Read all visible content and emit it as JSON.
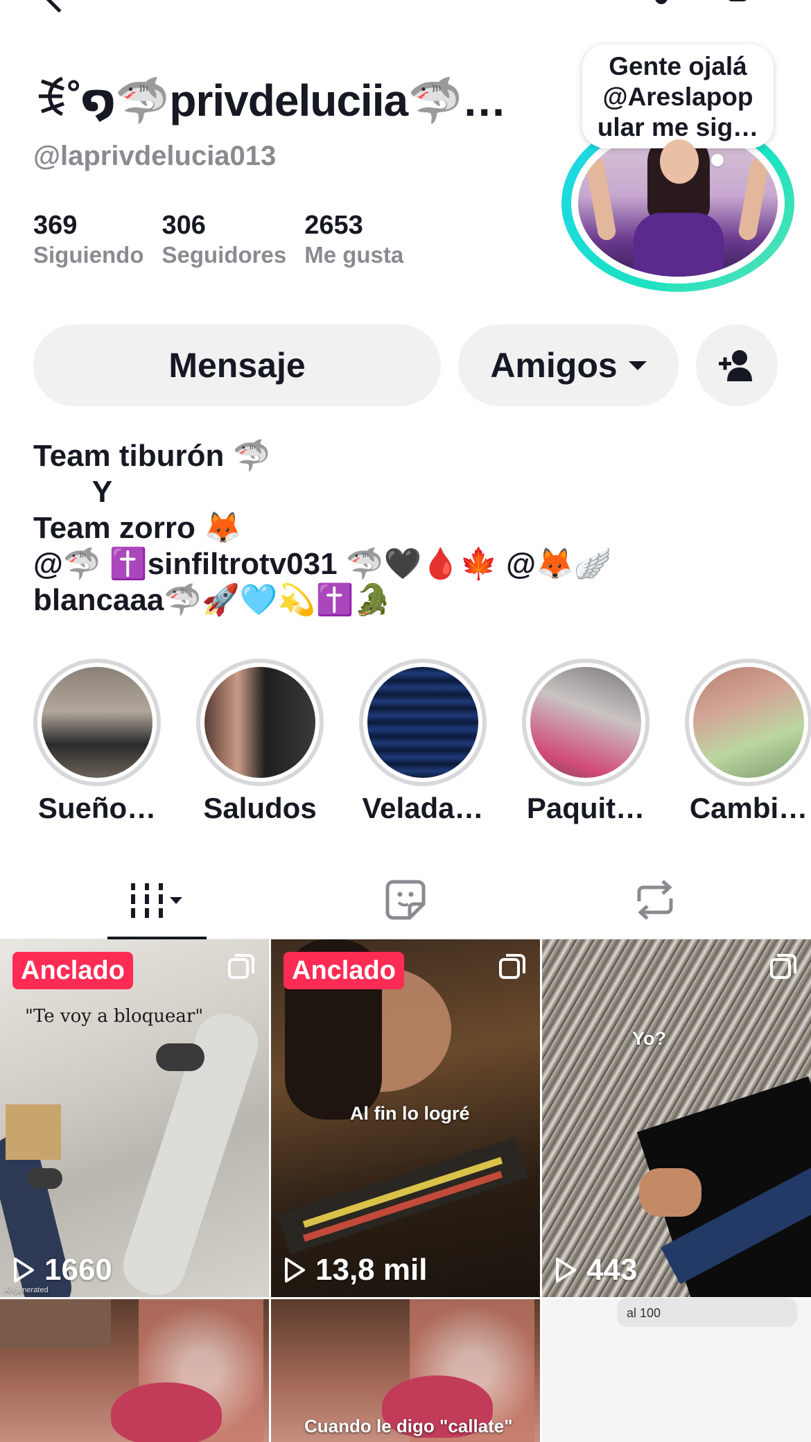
{
  "profile": {
    "display_name": "ꉂ˚໑🦈privdeluciia🦈…",
    "username": "@laprivdelucia013",
    "stats": [
      {
        "value": "369",
        "label": "Siguiendo"
      },
      {
        "value": "306",
        "label": "Seguidores"
      },
      {
        "value": "2653",
        "label": "Me gusta"
      }
    ],
    "note_bubble": "Gente ojalá\n@Areslapop\nular me sig…",
    "avatar_ring_color": "#20d5ec"
  },
  "actions": {
    "message_label": "Mensaje",
    "friends_label": "Amigos",
    "add_friend_icon": "add-user-icon"
  },
  "bio": "Team tiburón 🦈\n       Y\nTeam zorro 🦊\n@🦈 ✝️sinfiltrotv031 🦈🖤🩸🍁 @🦊🪽\nblancaaa🦈🚀🩵💫✝️🐊",
  "highlights": [
    {
      "label": "Sueño…"
    },
    {
      "label": "Saludos"
    },
    {
      "label": "Velada…"
    },
    {
      "label": "Paquit…"
    },
    {
      "label": "Cambi…"
    }
  ],
  "tabs": {
    "videos_icon": "videos-grid-icon",
    "stickers_icon": "sticker-icon",
    "reposts_icon": "repost-icon"
  },
  "videos": [
    {
      "pinned": "Anclado",
      "caption": "\"Te voy a bloquear\"",
      "views": "1660",
      "badge": "AI-generated"
    },
    {
      "pinned": "Anclado",
      "caption": "Al fin lo logré",
      "views": "13,8 mil"
    },
    {
      "caption": "Yo?",
      "views": "443"
    },
    {},
    {
      "caption": "Cuando le digo \"callate\""
    },
    {
      "caption": "al 100"
    }
  ],
  "colors": {
    "pin_badge": "#fe2c55",
    "muted_text": "#8a8b91",
    "button_bg": "#f1f1f2"
  }
}
